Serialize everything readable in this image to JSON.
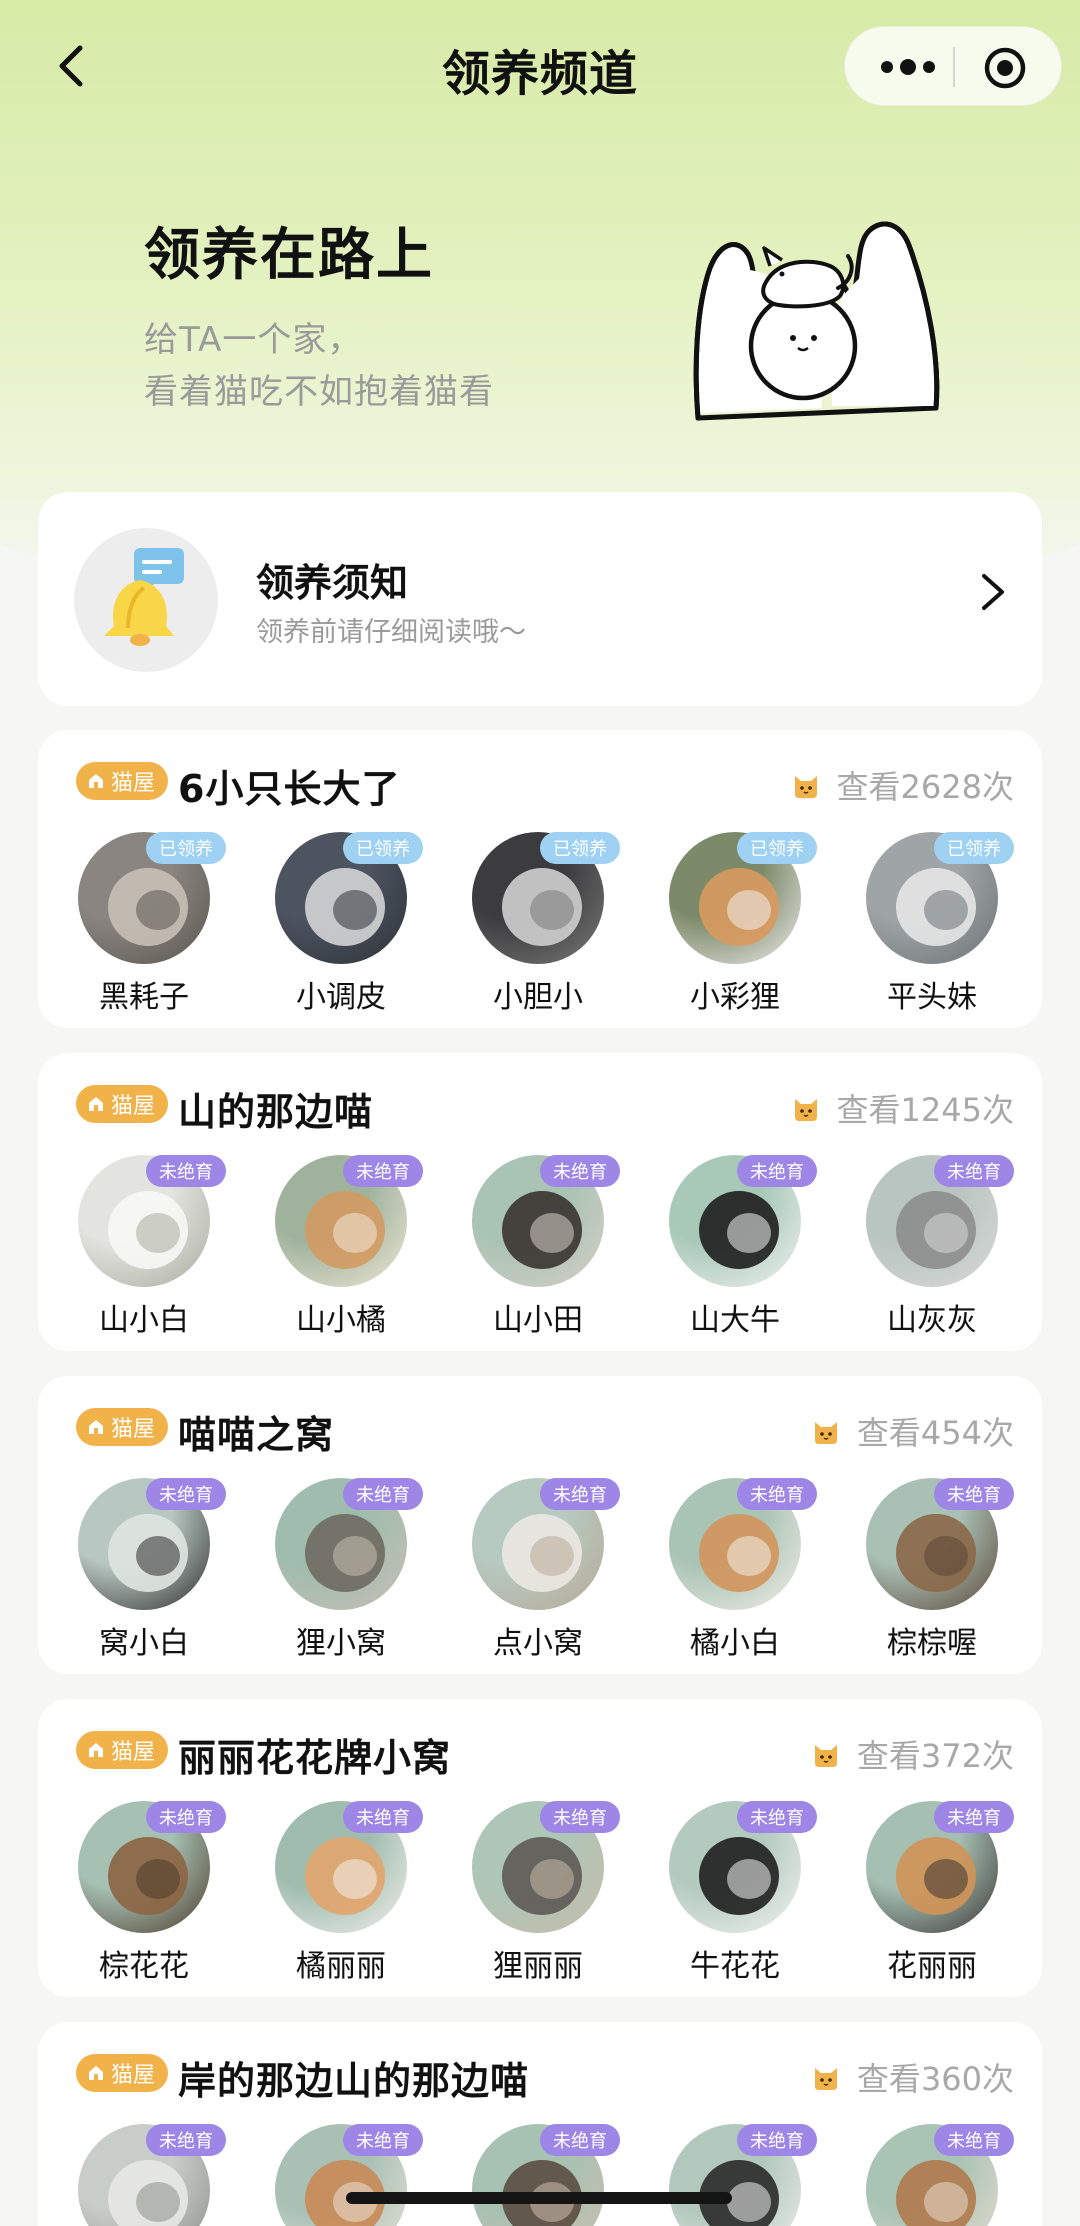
{
  "nav": {
    "title": "领养频道",
    "back_icon": "chevron-left-icon",
    "more_icon": "more-dots-icon",
    "close_icon": "target-circle-icon"
  },
  "hero": {
    "title": "领养在路上",
    "subtitle_line1": "给TA一个家，",
    "subtitle_line2": "看着猫吃不如抱着猫看",
    "illustration": "hug-cat-illustration"
  },
  "notice": {
    "title": "领养须知",
    "subtitle": "领养前请仔细阅读哦～",
    "icon": "bell-icon"
  },
  "colors": {
    "badge": "#f2b24a",
    "tag_adopted": "#9fd1f3",
    "tag_unsterilized": "#9d86e6",
    "muted_text": "#9a9a9a",
    "hero_green": "#d7eba7"
  },
  "groups": [
    {
      "badge": "猫屋",
      "title": "6小只长大了",
      "views": "查看2628次",
      "cats": [
        {
          "name": "黑耗子",
          "tag": "已领养",
          "tag_type": "adopted",
          "colors": [
            "#8a8580",
            "#c6c0b6",
            "#5a554f"
          ]
        },
        {
          "name": "小调皮",
          "tag": "已领养",
          "tag_type": "adopted",
          "colors": [
            "#4c5460",
            "#d4d4d4",
            "#2e3138"
          ]
        },
        {
          "name": "小胆小",
          "tag": "已领养",
          "tag_type": "adopted",
          "colors": [
            "#3c3c3e",
            "#cfcfcf",
            "#7a7a7a"
          ]
        },
        {
          "name": "小彩狸",
          "tag": "已领养",
          "tag_type": "adopted",
          "colors": [
            "#7d8a6a",
            "#d99a5e",
            "#eeeeee"
          ]
        },
        {
          "name": "平头妹",
          "tag": "已领养",
          "tag_type": "adopted",
          "colors": [
            "#9fa4a6",
            "#e6e6e6",
            "#6c7276"
          ]
        }
      ]
    },
    {
      "badge": "猫屋",
      "title": "山的那边喵",
      "views": "查看1245次",
      "cats": [
        {
          "name": "山小白",
          "tag": "未绝育",
          "tag_type": "unsterile",
          "colors": [
            "#e3e3df",
            "#f7f7f5",
            "#a9ab9e"
          ]
        },
        {
          "name": "山小橘",
          "tag": "未绝育",
          "tag_type": "unsterile",
          "colors": [
            "#9fb39c",
            "#d39a62",
            "#f1e8d8"
          ]
        },
        {
          "name": "山小田",
          "tag": "未绝育",
          "tag_type": "unsterile",
          "colors": [
            "#a9c3b4",
            "#3a3330",
            "#d6cfc6"
          ]
        },
        {
          "name": "山大牛",
          "tag": "未绝育",
          "tag_type": "unsterile",
          "colors": [
            "#a8c9b8",
            "#1e1e1e",
            "#f2f2f2"
          ]
        },
        {
          "name": "山灰灰",
          "tag": "未绝育",
          "tag_type": "unsterile",
          "colors": [
            "#b9c5c0",
            "#8d8d8d",
            "#d9d9d9"
          ]
        }
      ]
    },
    {
      "badge": "猫屋",
      "title": "喵喵之窝",
      "views": "查看454次",
      "cats": [
        {
          "name": "窝小白",
          "tag": "未绝育",
          "tag_type": "unsterile",
          "colors": [
            "#b8c7c1",
            "#dfe4e1",
            "#2b2b2b"
          ]
        },
        {
          "name": "狸小窝",
          "tag": "未绝育",
          "tag_type": "unsterile",
          "colors": [
            "#9fbcae",
            "#6f6a62",
            "#c9c0b3"
          ]
        },
        {
          "name": "点小窝",
          "tag": "未绝育",
          "tag_type": "unsterile",
          "colors": [
            "#b6cac0",
            "#ece8e2",
            "#b8a896"
          ]
        },
        {
          "name": "橘小白",
          "tag": "未绝育",
          "tag_type": "unsterile",
          "colors": [
            "#a9c3b4",
            "#d2955c",
            "#f3efe9"
          ]
        },
        {
          "name": "棕棕喔",
          "tag": "未绝育",
          "tag_type": "unsterile",
          "colors": [
            "#a9c0b5",
            "#8b6848",
            "#5a4536"
          ]
        }
      ]
    },
    {
      "badge": "猫屋",
      "title": "丽丽花花牌小窝",
      "views": "查看372次",
      "cats": [
        {
          "name": "棕花花",
          "tag": "未绝育",
          "tag_type": "unsterile",
          "colors": [
            "#a6c1b3",
            "#8c6442",
            "#4d3a2a"
          ]
        },
        {
          "name": "橘丽丽",
          "tag": "未绝育",
          "tag_type": "unsterile",
          "colors": [
            "#9fbcae",
            "#e1a46b",
            "#f4f1ec"
          ]
        },
        {
          "name": "狸丽丽",
          "tag": "未绝育",
          "tag_type": "unsterile",
          "colors": [
            "#adc6b8",
            "#5e5954",
            "#c8bba8"
          ]
        },
        {
          "name": "牛花花",
          "tag": "未绝育",
          "tag_type": "unsterile",
          "colors": [
            "#b3cabe",
            "#1f1f1f",
            "#f3f3f3"
          ]
        },
        {
          "name": "花丽丽",
          "tag": "未绝育",
          "tag_type": "unsterile",
          "colors": [
            "#a5c0b2",
            "#d09356",
            "#3a3431"
          ]
        }
      ]
    },
    {
      "badge": "猫屋",
      "title": "岸的那边山的那边喵",
      "views": "查看360次",
      "cats": [
        {
          "name": "",
          "tag": "未绝育",
          "tag_type": "unsterile",
          "colors": [
            "#c9cdca",
            "#e8e8e6",
            "#8d8f8a"
          ]
        },
        {
          "name": "",
          "tag": "未绝育",
          "tag_type": "unsterile",
          "colors": [
            "#a9c0b5",
            "#c98a55",
            "#e9e2d6"
          ]
        },
        {
          "name": "",
          "tag": "未绝育",
          "tag_type": "unsterile",
          "colors": [
            "#a7c1b3",
            "#5b4c40",
            "#cdbfae"
          ]
        },
        {
          "name": "",
          "tag": "未绝育",
          "tag_type": "unsterile",
          "colors": [
            "#b2c8bc",
            "#2a2a2a",
            "#eeeeee"
          ]
        },
        {
          "name": "",
          "tag": "未绝育",
          "tag_type": "unsterile",
          "colors": [
            "#a9c3b4",
            "#b07a4d",
            "#e8ddd0"
          ]
        }
      ]
    }
  ]
}
